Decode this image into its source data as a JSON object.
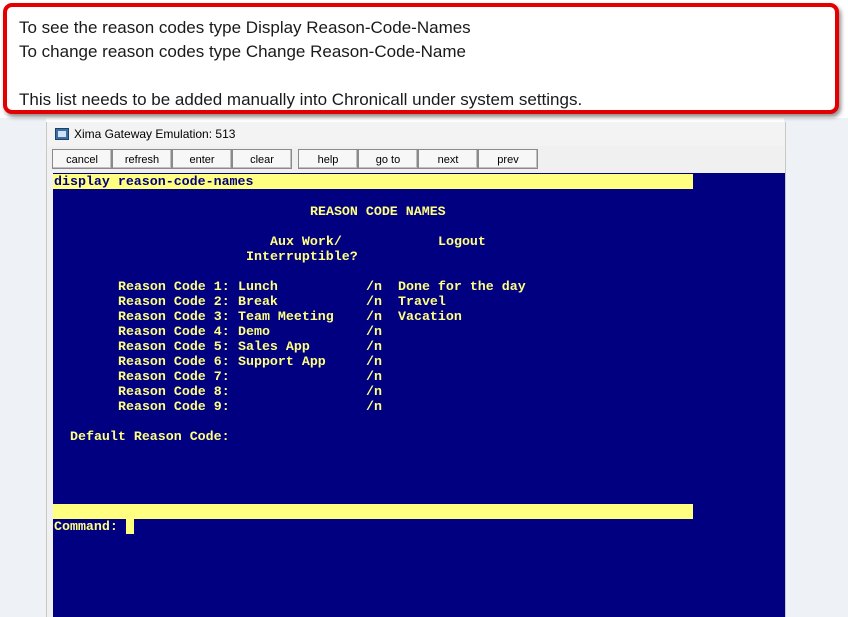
{
  "callout": {
    "line1": "To see the reason codes type Display Reason-Code-Names",
    "line2": "To change reason codes type Change Reason-Code-Name",
    "line3": "",
    "line4": "This list needs to be added manually into Chronicall under system settings."
  },
  "window": {
    "title": "Xima Gateway Emulation: 513"
  },
  "toolbar": {
    "cancel": "cancel",
    "refresh": "refresh",
    "enter": "enter",
    "clear": "clear",
    "help": "help",
    "goto_page": "go to page",
    "next_page": "next page",
    "prev_page": "prev page"
  },
  "terminal": {
    "command_line": "display reason-code-names",
    "heading": "REASON CODE NAMES",
    "col_aux_header": "Aux Work/",
    "col_logout_header": "Logout",
    "col_aux_header2": "Interruptible?",
    "rows": [
      {
        "label": "Reason Code 1:",
        "aux": "Lunch",
        "flag": "/n",
        "logout": "Done for the day"
      },
      {
        "label": "Reason Code 2:",
        "aux": "Break",
        "flag": "/n",
        "logout": "Travel"
      },
      {
        "label": "Reason Code 3:",
        "aux": "Team Meeting",
        "flag": "/n",
        "logout": "Vacation"
      },
      {
        "label": "Reason Code 4:",
        "aux": "Demo",
        "flag": "/n",
        "logout": ""
      },
      {
        "label": "Reason Code 5:",
        "aux": "Sales App",
        "flag": "/n",
        "logout": ""
      },
      {
        "label": "Reason Code 6:",
        "aux": "Support App",
        "flag": "/n",
        "logout": ""
      },
      {
        "label": "Reason Code 7:",
        "aux": "",
        "flag": "/n",
        "logout": ""
      },
      {
        "label": "Reason Code 8:",
        "aux": "",
        "flag": "/n",
        "logout": ""
      },
      {
        "label": "Reason Code 9:",
        "aux": "",
        "flag": "/n",
        "logout": ""
      }
    ],
    "default_label": "Default Reason Code:",
    "command_prompt": "Command:"
  },
  "colors": {
    "terminal_bg": "#000080",
    "terminal_fg": "#ffff80",
    "callout_border": "#e40000"
  }
}
